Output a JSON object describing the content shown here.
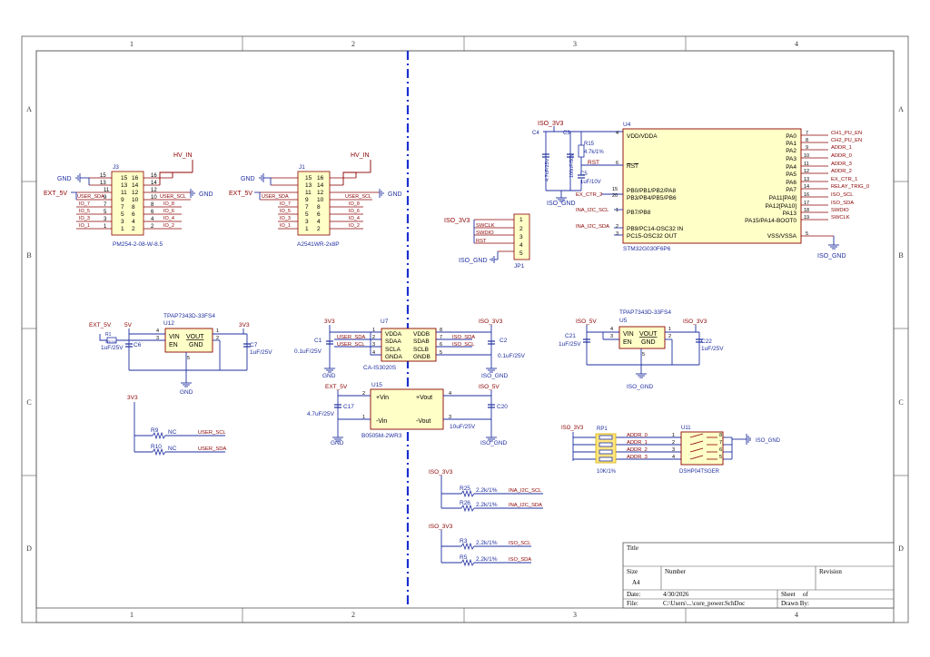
{
  "border": {
    "cols": [
      "1",
      "2",
      "3",
      "4"
    ],
    "rows": [
      "A",
      "B",
      "C",
      "D"
    ]
  },
  "colors": {
    "wire": "#1f2fa0",
    "part": "#8b0000",
    "partfill": "#ffffc8",
    "netlabel": "#8b0000",
    "divider": "#1a2fd0",
    "rpfill": "#ffe680"
  },
  "j_left": {
    "ref": "J3",
    "name": "PM254-2-08-W-8.5",
    "power_top": "HV_IN",
    "gnd_left": "GND",
    "ext": "EXT_5V",
    "gnd_right": "GND",
    "nets_left": [
      "USER_SDA",
      "IO_7",
      "IO_5",
      "IO_3",
      "IO_1"
    ],
    "nets_right": [
      "USER_SCL",
      "IO_8",
      "IO_6",
      "IO_4",
      "IO_2"
    ],
    "pins_left": [
      "15",
      "13",
      "11",
      "9",
      "7",
      "5",
      "3",
      "1"
    ],
    "pins_inner_left": [
      "15",
      "13",
      "11",
      "9",
      "7",
      "5",
      "3",
      "1"
    ],
    "pins_inner_right": [
      "16",
      "14",
      "12",
      "10",
      "8",
      "6",
      "4",
      "2"
    ],
    "pins_right": [
      "16",
      "14",
      "12",
      "10",
      "8",
      "6",
      "4",
      "2"
    ]
  },
  "j_mid": {
    "ref": "J1",
    "name": "A2541WR-2x8P",
    "power_top": "HV_IN",
    "gnd_left": "GND",
    "ext": "EXT_5V",
    "gnd_right": "GND",
    "nets_left": [
      "USER_SDA",
      "IO_7",
      "IO_5",
      "IO_3",
      "IO_1"
    ],
    "nets_right": [
      "USER_SCL",
      "IO_8",
      "IO_6",
      "IO_4",
      "IO_2"
    ]
  },
  "mcu": {
    "ref": "U4",
    "name": "STM32G030F6P6",
    "left_pins": [
      {
        "num": "4",
        "label": "VDD/VDDA"
      },
      {
        "num": "6",
        "label": "RST"
      },
      {
        "num": "15",
        "label": "PB0/PB1/PB2/PA8"
      },
      {
        "num": "20",
        "label": "PB3/PB4/PB5/PB6"
      },
      {
        "num": "1",
        "label": "PB7/PB8"
      },
      {
        "num": "2",
        "label": "PB9/PC14-OSC32 IN"
      },
      {
        "num": "3",
        "label": "PC15-OSC32 OUT"
      }
    ],
    "right_pins": [
      {
        "num": "7",
        "label": "PA0",
        "net": "CH1_PU_EN"
      },
      {
        "num": "8",
        "label": "PA1",
        "net": "CH2_PU_EN"
      },
      {
        "num": "9",
        "label": "PA2",
        "net": "ADDR_1"
      },
      {
        "num": "10",
        "label": "PA3",
        "net": "ADDR_0"
      },
      {
        "num": "11",
        "label": "PA4",
        "net": "ADDR_3"
      },
      {
        "num": "12",
        "label": "PA5",
        "net": "ADDR_2"
      },
      {
        "num": "13",
        "label": "PA6",
        "net": "EX_CTR_1"
      },
      {
        "num": "14",
        "label": "PA7",
        "net": "RELAY_TRIG_0"
      },
      {
        "num": "16",
        "label": "PA11[PA9]",
        "net": "ISO_SCL"
      },
      {
        "num": "17",
        "label": "PA12[PA10]",
        "net": "ISO_SDA"
      },
      {
        "num": "18",
        "label": "PA13",
        "net": "SWDIO"
      },
      {
        "num": "19",
        "label": "PA15/PA14-BOOT0",
        "net": "SWCLK"
      },
      {
        "num": "5",
        "label": "VSS/VSSA",
        "net": ""
      }
    ],
    "supply": "ISO_3V3",
    "gnd1": "ISO_GND",
    "gnd2": "ISO_GND",
    "c4": "C4",
    "c4v": "4.7uF/25V",
    "c3": "C3",
    "c3v": "100nF/50V",
    "r15": "R15",
    "r15v": "4.7k/1%",
    "c5": "C5",
    "c5v": "1uF/10V",
    "rst": "RST",
    "ex2": "EX_CTR_2",
    "inascl": "INA_I2C_SCL",
    "inasda": "INA_I2C_SDA"
  },
  "jp1": {
    "ref": "JP1",
    "supply": "ISO_3V3",
    "gnd": "ISO_GND",
    "nets": [
      "SWCLK",
      "SWDIO",
      "RST"
    ],
    "pins": [
      "1",
      "2",
      "3",
      "4",
      "5"
    ]
  },
  "u12": {
    "title": "TPAP7343D-33FS4",
    "ref": "U12",
    "vin": "VIN",
    "vout": "VOUT",
    "en": "EN",
    "gnd": "GND",
    "ext": "EXT_5V",
    "v5": "5V",
    "v33": "3V3",
    "r": "R1",
    "rv": "0R/1%",
    "c6": "C6",
    "c6v": "1uF/25V",
    "c7": "C7",
    "c7v": "1uF/25V",
    "gnd_label": "GND",
    "pins": [
      "4",
      "3",
      "1",
      "2",
      "5"
    ]
  },
  "u5": {
    "title": "TPAP7343D-33FS4",
    "ref": "U5",
    "vin": "VIN",
    "vout": "VOUT",
    "en": "EN",
    "gnd": "GND",
    "in": "ISO_5V",
    "out": "ISO_3V3",
    "c21": "C21",
    "c21v": "1uF/25V",
    "c22": "C22",
    "c22v": "1uF/25V",
    "gnd_label": "ISO_GND",
    "pins": [
      "4",
      "3",
      "1",
      "2",
      "5"
    ]
  },
  "u7": {
    "ref": "U7",
    "name": "CA-IS3020S",
    "left": [
      "VDDA",
      "SDAA",
      "SCLA",
      "GNDA"
    ],
    "right": [
      "VDDB",
      "SDAB",
      "SCLB",
      "GNDB"
    ],
    "pins_l": [
      "1",
      "2",
      "3",
      "4"
    ],
    "pins_r": [
      "8",
      "7",
      "6",
      "5"
    ],
    "nets_l": [
      "USER_SDA",
      "USER_SCL"
    ],
    "nets_r": [
      "ISO_SDA",
      "ISO_SCL"
    ],
    "v_l": "3V3",
    "v_r": "ISO_3V3",
    "c1": "C1",
    "c1v": "0.1uF/25V",
    "c2": "C2",
    "c2v": "0.1uF/25V",
    "gnd_l": "GND",
    "gnd_r": "ISO_GND"
  },
  "u15": {
    "ref": "U15",
    "name": "B0505M-2WR3",
    "pins_l": [
      "+Vin",
      "-Vin"
    ],
    "pins_r": [
      "+Vout",
      "-Vout"
    ],
    "nums_l": [
      "2",
      "1"
    ],
    "nums_r": [
      "4",
      "3"
    ],
    "in": "EXT_5V",
    "out": "ISO_5V",
    "c17": "C17",
    "c17v": "4.7uF/25V",
    "c20": "C20",
    "c20v": "10uF/25V",
    "gnd_l": "GND",
    "gnd_r": "ISO_GND"
  },
  "pullups": {
    "supply": "3V3",
    "r9": "R9",
    "r10": "R10",
    "nc": "NC",
    "n9": "USER_SCL",
    "n10": "USER_SDA"
  },
  "ina_pullups": {
    "supply": "ISO_3V3",
    "r25": "R25",
    "r26": "R26",
    "v": "2.2k/1%",
    "n25": "INA_I2C_SCL",
    "n26": "INA_I2C_SDA"
  },
  "iso_pullups": {
    "supply": "ISO_3V3",
    "r3": "R3",
    "r5": "R5",
    "v": "2.2k/1%",
    "n3": "ISO_SCL",
    "n5": "ISO_SDA"
  },
  "addr": {
    "supply": "ISO_3V3",
    "rp": "RP1",
    "rpv": "10K/1%",
    "u": "U11",
    "uname": "DSHP04TSGER",
    "gnd": "ISO_GND",
    "nets": [
      "ADDR_0",
      "ADDR_1",
      "ADDR_2",
      "ADDR_3"
    ],
    "pins_l": [
      "1",
      "2",
      "3",
      "4"
    ],
    "pins_r": [
      "8",
      "7",
      "6",
      "5"
    ]
  },
  "title_block": {
    "title": "Title",
    "size": "Size",
    "size_val": "A4",
    "number": "Number",
    "revision": "Revision",
    "date": "Date:",
    "date_val": "4/30/2026",
    "sheet": "Sheet",
    "of": "of",
    "file": "File:",
    "file_val": "C:\\Users\\...\\core_power.SchDoc",
    "drawn": "Drawn By:"
  }
}
